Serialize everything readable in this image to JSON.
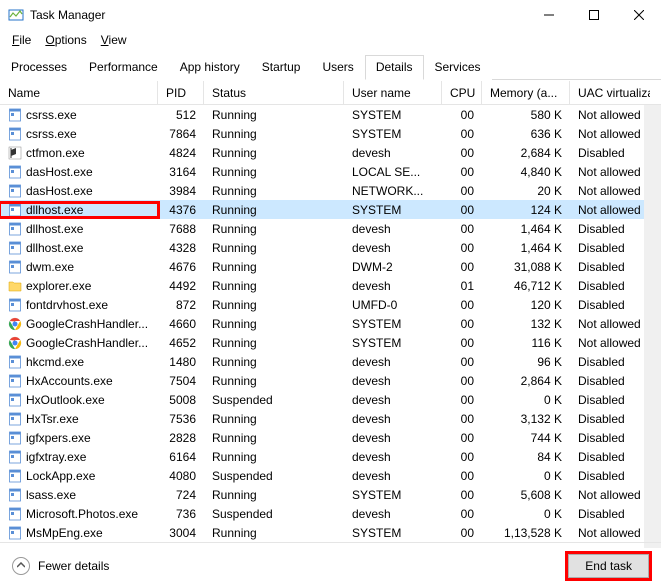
{
  "window": {
    "title": "Task Manager",
    "min": "—",
    "max": "☐",
    "close": "✕"
  },
  "menu": {
    "file": "File",
    "options": "Options",
    "view": "View"
  },
  "tabs": {
    "processes": "Processes",
    "performance": "Performance",
    "app_history": "App history",
    "startup": "Startup",
    "users": "Users",
    "details": "Details",
    "services": "Services"
  },
  "columns": {
    "name": "Name",
    "pid": "PID",
    "status": "Status",
    "user": "User name",
    "cpu": "CPU",
    "mem": "Memory (a...",
    "uac": "UAC virtualizat..."
  },
  "rows": [
    {
      "icon": "app",
      "name": "csrss.exe",
      "pid": "512",
      "status": "Running",
      "user": "SYSTEM",
      "cpu": "00",
      "mem": "580 K",
      "uac": "Not allowed",
      "sel": false
    },
    {
      "icon": "app",
      "name": "csrss.exe",
      "pid": "7864",
      "status": "Running",
      "user": "SYSTEM",
      "cpu": "00",
      "mem": "636 K",
      "uac": "Not allowed",
      "sel": false
    },
    {
      "icon": "ctf",
      "name": "ctfmon.exe",
      "pid": "4824",
      "status": "Running",
      "user": "devesh",
      "cpu": "00",
      "mem": "2,684 K",
      "uac": "Disabled",
      "sel": false
    },
    {
      "icon": "app",
      "name": "dasHost.exe",
      "pid": "3164",
      "status": "Running",
      "user": "LOCAL SE...",
      "cpu": "00",
      "mem": "4,840 K",
      "uac": "Not allowed",
      "sel": false
    },
    {
      "icon": "app",
      "name": "dasHost.exe",
      "pid": "3984",
      "status": "Running",
      "user": "NETWORK...",
      "cpu": "00",
      "mem": "20 K",
      "uac": "Not allowed",
      "sel": false
    },
    {
      "icon": "app",
      "name": "dllhost.exe",
      "pid": "4376",
      "status": "Running",
      "user": "SYSTEM",
      "cpu": "00",
      "mem": "124 K",
      "uac": "Not allowed",
      "sel": true,
      "highlight": true
    },
    {
      "icon": "app",
      "name": "dllhost.exe",
      "pid": "7688",
      "status": "Running",
      "user": "devesh",
      "cpu": "00",
      "mem": "1,464 K",
      "uac": "Disabled",
      "sel": false
    },
    {
      "icon": "app",
      "name": "dllhost.exe",
      "pid": "4328",
      "status": "Running",
      "user": "devesh",
      "cpu": "00",
      "mem": "1,464 K",
      "uac": "Disabled",
      "sel": false
    },
    {
      "icon": "app",
      "name": "dwm.exe",
      "pid": "4676",
      "status": "Running",
      "user": "DWM-2",
      "cpu": "00",
      "mem": "31,088 K",
      "uac": "Disabled",
      "sel": false
    },
    {
      "icon": "folder",
      "name": "explorer.exe",
      "pid": "4492",
      "status": "Running",
      "user": "devesh",
      "cpu": "01",
      "mem": "46,712 K",
      "uac": "Disabled",
      "sel": false
    },
    {
      "icon": "app",
      "name": "fontdrvhost.exe",
      "pid": "872",
      "status": "Running",
      "user": "UMFD-0",
      "cpu": "00",
      "mem": "120 K",
      "uac": "Disabled",
      "sel": false
    },
    {
      "icon": "chrome",
      "name": "GoogleCrashHandler...",
      "pid": "4660",
      "status": "Running",
      "user": "SYSTEM",
      "cpu": "00",
      "mem": "132 K",
      "uac": "Not allowed",
      "sel": false
    },
    {
      "icon": "chrome",
      "name": "GoogleCrashHandler...",
      "pid": "4652",
      "status": "Running",
      "user": "SYSTEM",
      "cpu": "00",
      "mem": "116 K",
      "uac": "Not allowed",
      "sel": false
    },
    {
      "icon": "app",
      "name": "hkcmd.exe",
      "pid": "1480",
      "status": "Running",
      "user": "devesh",
      "cpu": "00",
      "mem": "96 K",
      "uac": "Disabled",
      "sel": false
    },
    {
      "icon": "app",
      "name": "HxAccounts.exe",
      "pid": "7504",
      "status": "Running",
      "user": "devesh",
      "cpu": "00",
      "mem": "2,864 K",
      "uac": "Disabled",
      "sel": false
    },
    {
      "icon": "app",
      "name": "HxOutlook.exe",
      "pid": "5008",
      "status": "Suspended",
      "user": "devesh",
      "cpu": "00",
      "mem": "0 K",
      "uac": "Disabled",
      "sel": false
    },
    {
      "icon": "app",
      "name": "HxTsr.exe",
      "pid": "7536",
      "status": "Running",
      "user": "devesh",
      "cpu": "00",
      "mem": "3,132 K",
      "uac": "Disabled",
      "sel": false
    },
    {
      "icon": "app",
      "name": "igfxpers.exe",
      "pid": "2828",
      "status": "Running",
      "user": "devesh",
      "cpu": "00",
      "mem": "744 K",
      "uac": "Disabled",
      "sel": false
    },
    {
      "icon": "app",
      "name": "igfxtray.exe",
      "pid": "6164",
      "status": "Running",
      "user": "devesh",
      "cpu": "00",
      "mem": "84 K",
      "uac": "Disabled",
      "sel": false
    },
    {
      "icon": "app",
      "name": "LockApp.exe",
      "pid": "4080",
      "status": "Suspended",
      "user": "devesh",
      "cpu": "00",
      "mem": "0 K",
      "uac": "Disabled",
      "sel": false
    },
    {
      "icon": "app",
      "name": "lsass.exe",
      "pid": "724",
      "status": "Running",
      "user": "SYSTEM",
      "cpu": "00",
      "mem": "5,608 K",
      "uac": "Not allowed",
      "sel": false
    },
    {
      "icon": "app",
      "name": "Microsoft.Photos.exe",
      "pid": "736",
      "status": "Suspended",
      "user": "devesh",
      "cpu": "00",
      "mem": "0 K",
      "uac": "Disabled",
      "sel": false
    },
    {
      "icon": "app",
      "name": "MsMpEng.exe",
      "pid": "3004",
      "status": "Running",
      "user": "SYSTEM",
      "cpu": "00",
      "mem": "1,13,528 K",
      "uac": "Not allowed",
      "sel": false
    }
  ],
  "footer": {
    "fewer": "Fewer details",
    "endtask": "End task"
  }
}
